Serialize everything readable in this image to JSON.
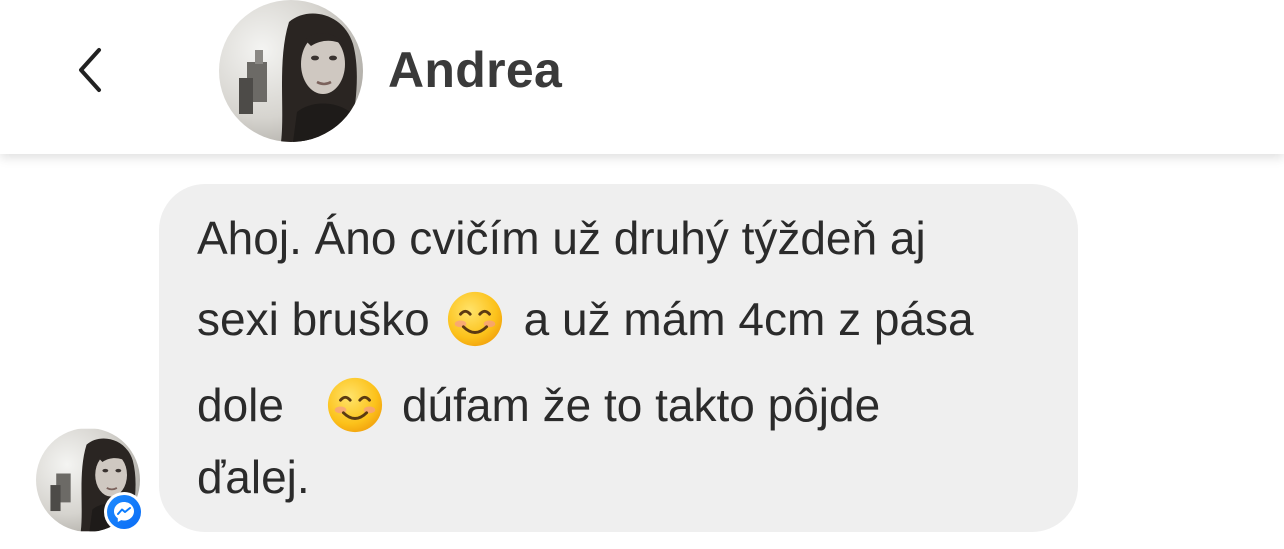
{
  "header": {
    "back_icon": "chevron-left-icon",
    "contact_name": "Andrea",
    "avatar": "contact-avatar"
  },
  "message": {
    "lines": [
      "Ahoj. Áno cvičím už druhý týždeň aj",
      "sexi bruško",
      "a už mám 4cm z pása",
      "dole",
      "dúfam že to takto pôjde",
      "ďalej."
    ],
    "emoji": "smiling-face-icon",
    "bubble_color": "#efefef"
  },
  "sender": {
    "avatar": "contact-avatar",
    "badge": "messenger-icon",
    "badge_color": "#0a7cff"
  }
}
